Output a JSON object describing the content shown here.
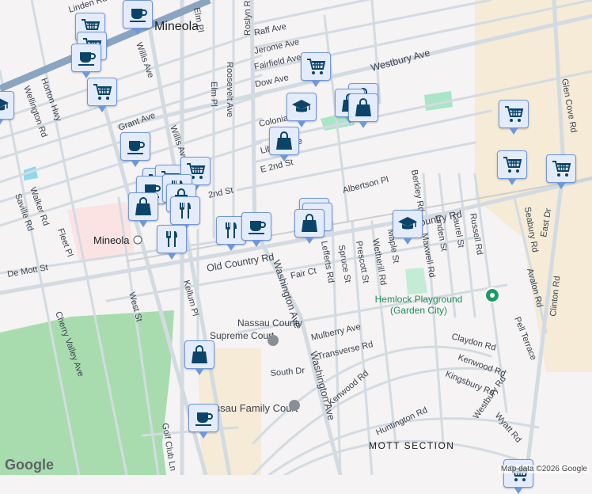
{
  "map": {
    "places": {
      "city": "Mineola",
      "station": "Mineola",
      "neighborhood": "MOTT SECTION"
    },
    "pois": {
      "park": "Hemlock Playground (Garden City)",
      "court1_line1": "Nassau County",
      "court1_line2": "Supreme Court",
      "court2": "Nassau Family Court"
    },
    "roads": [
      "Linden Rd",
      "Elm Pl",
      "Roslyn Rd",
      "Raff Ave",
      "Jerome Ave",
      "Fairfield Ave",
      "Dow Ave",
      "Westbury Ave",
      "Colonial",
      "Liberty Ave",
      "E 2nd St",
      "2nd St",
      "Albertson Pl",
      "Old Country Rd",
      "Willis Ave",
      "Roosevelt Ave",
      "Elm Pl",
      "Grant Ave",
      "Horton Hwy",
      "Wellington Rd",
      "Walker Rd",
      "Saville Rd",
      "Fleet Pl",
      "De Mott St",
      "West St",
      "Kellum Pl",
      "Cherry Valley Ave",
      "Fair Ct",
      "Washington Ave",
      "Lefferts Rd",
      "Spruce St",
      "Prescott St",
      "Wetherill Rd",
      "Maple St",
      "Maxwell Rd",
      "Berkley Rd",
      "Linden St",
      "Laurel St",
      "Russell Rd",
      "Seabury Rd",
      "East Dr",
      "Avalon Rd",
      "Pell Terrace",
      "Clinton Rd",
      "Glen Cove Rd",
      "Mulberry Ave",
      "Claydon Rd",
      "Transverse Rd",
      "Kenwood Rd",
      "Kingsbury Rd",
      "Westbury Rd",
      "Wyatt Rd",
      "South Dr",
      "Huntington Rd",
      "Golf Club Ln",
      "Washington Ave",
      "Old Country Rd"
    ],
    "marker_types": [
      "shopping-cart",
      "coffee-cup",
      "shopping-bag",
      "restaurant",
      "school",
      "park"
    ],
    "attribution": "Map data ©2026 Google",
    "logo": "Google"
  }
}
